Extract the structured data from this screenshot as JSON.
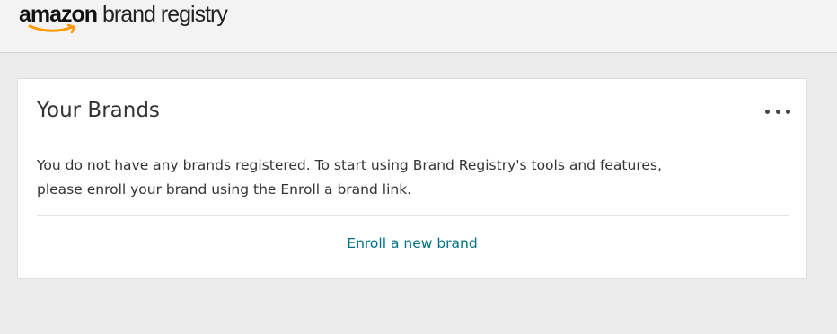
{
  "header": {
    "logo_brand": "amazon",
    "logo_product": "brand registry",
    "logo_smile_color": "#ff9900"
  },
  "brands_card": {
    "title": "Your Brands",
    "more_icon": "more-horizontal-icon",
    "message_line1": "You do not have any brands registered. To start using Brand Registry's tools and features,",
    "message_line2": "please enroll your brand using the Enroll a brand link.",
    "enroll_link_label": "Enroll a new brand",
    "link_color": "#007185"
  }
}
